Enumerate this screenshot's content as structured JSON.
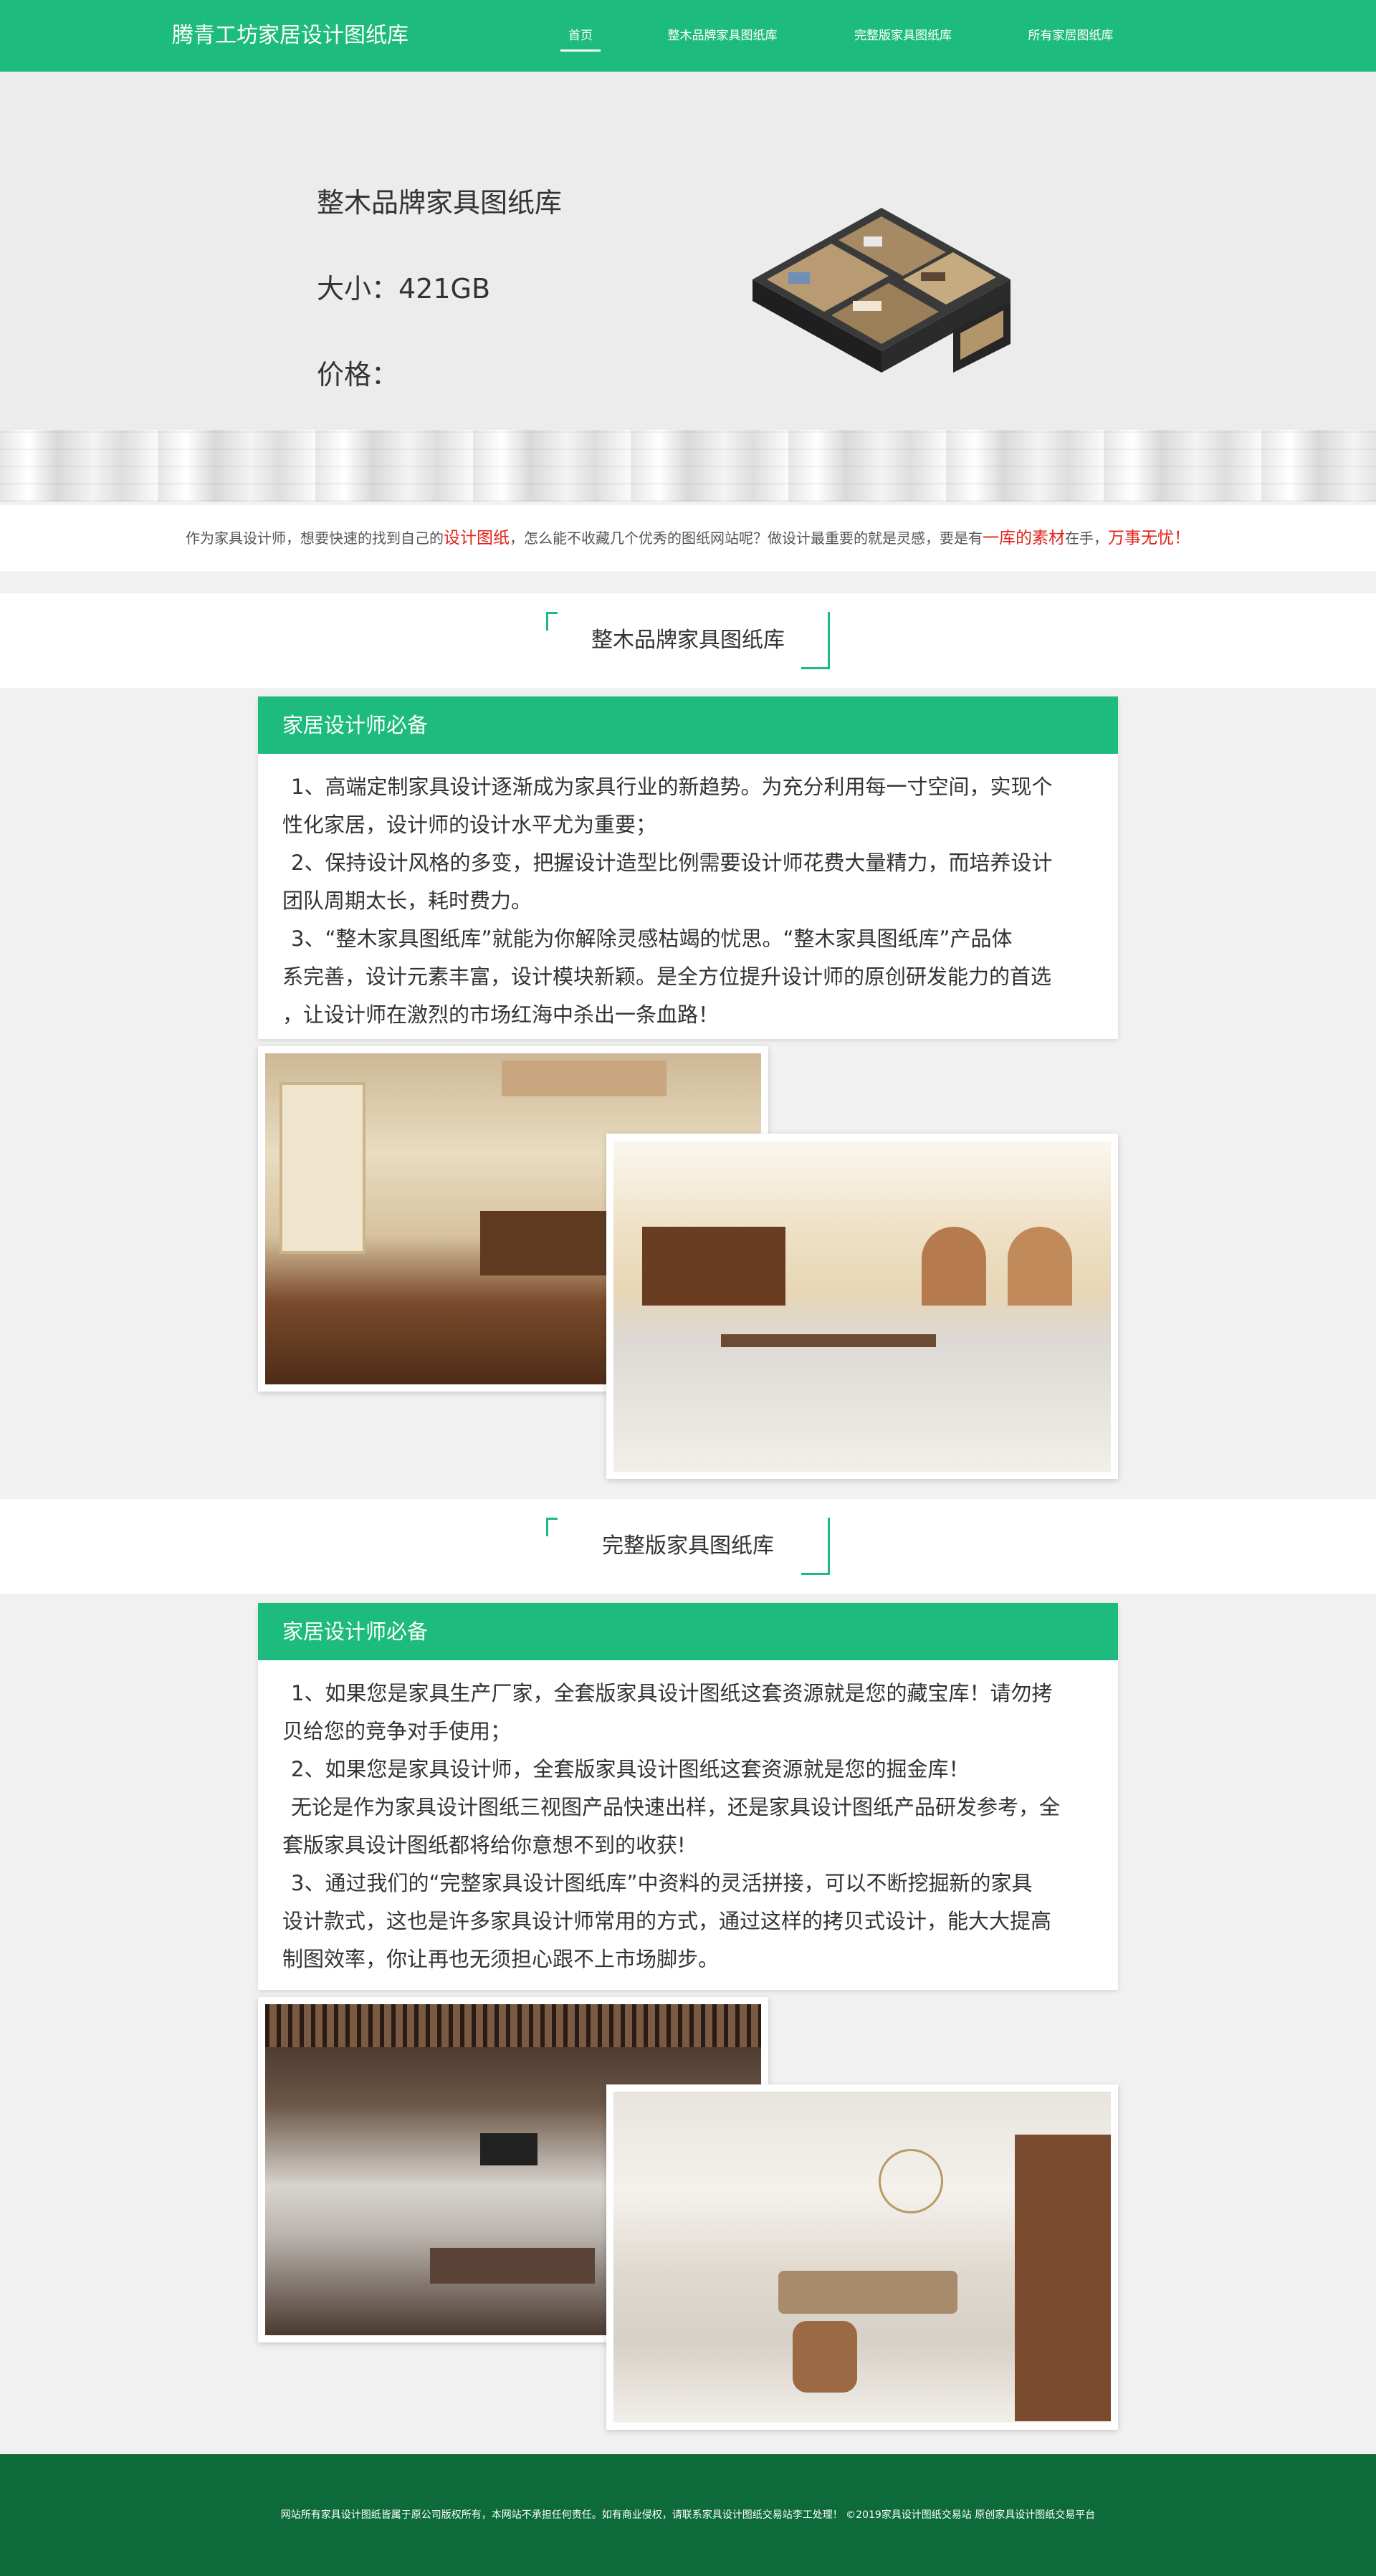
{
  "header": {
    "brand": "腾青工坊家居设计图纸库",
    "nav": [
      "首页",
      "整木品牌家具图纸库",
      "完整版家具图纸库",
      "所有家居图纸库"
    ]
  },
  "hero": {
    "title": "整木品牌家具图纸库",
    "size": "大小：421GB",
    "price": "价格："
  },
  "tagline": {
    "p1": "作为家具设计师，想要快速的找到自己的",
    "r1": "设计图纸",
    "p2": "，怎么能不收藏几个优秀的图纸网站呢？做设计最重要的就是灵感，要是有",
    "r2": "一库的素材",
    "p3": "在手，",
    "r3": "万事无忧！"
  },
  "section1": {
    "title": "整木品牌家具图纸库",
    "card_title": "家居设计师必备",
    "lines": [
      "1、高端定制家具设计逐渐成为家具行业的新趋势。为充分利用每一寸空间，实现个",
      "性化家居，设计师的设计水平尤为重要；",
      "2、保持设计风格的多变，把握设计造型比例需要设计师花费大量精力，而培养设计",
      "团队周期太长，耗时费力。",
      "3、“整木家具图纸库”就能为你解除灵感枯竭的忧思。“整木家具图纸库”产品体",
      "系完善，设计元素丰富，设计模块新颖。是全方位提升设计师的原创研发能力的首选",
      "，让设计师在激烈的市场红海中杀出一条血路！"
    ]
  },
  "section2": {
    "title": "完整版家具图纸库",
    "card_title": "家居设计师必备",
    "lines": [
      "1、如果您是家具生产厂家，全套版家具设计图纸这套资源就是您的藏宝库！请勿拷",
      "贝给您的竞争对手使用；",
      "2、如果您是家具设计师，全套版家具设计图纸这套资源就是您的掘金库！",
      "无论是作为家具设计图纸三视图产品快速出样，还是家具设计图纸产品研发参考，全",
      "套版家具设计图纸都将给你意想不到的收获!",
      "3、通过我们的“完整家具设计图纸库”中资料的灵活拼接，可以不断挖掘新的家具",
      "设计款式，这也是许多家具设计师常用的方式，通过这样的拷贝式设计，能大大提高",
      "制图效率，你让再也无须担心跟不上市场脚步。"
    ]
  },
  "footer": {
    "text": "网站所有家具设计图纸皆属于原公司版权所有，本网站不承担任何责任。如有商业侵权，请联系家具设计图纸交易站李工处理！ ©2019家具设计图纸交易站 原创家具设计图纸交易平台"
  },
  "colors": {
    "accent": "#1dbb7d",
    "footer": "#0d6b3a",
    "highlight": "#e3231c"
  }
}
